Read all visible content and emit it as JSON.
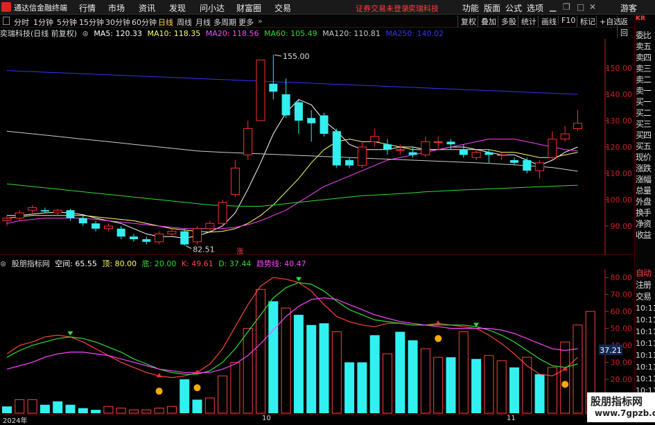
{
  "menubar": {
    "app_title": "通达信金融终端",
    "menus": [
      "行情",
      "市场",
      "资讯",
      "发现",
      "问小达",
      "财富圈",
      "交易"
    ],
    "notice": "证券交易未登录",
    "stock_name": "奕瑞科技",
    "right_items": [
      "功能",
      "版面",
      "公式",
      "选项"
    ],
    "guest": "游客"
  },
  "toolbar": {
    "periods": [
      "分时",
      "1分钟",
      "5分钟",
      "15分钟",
      "30分钟",
      "60分钟",
      "日线",
      "周线",
      "月线",
      "多周期",
      "更多"
    ],
    "active_period": "日线",
    "buttons": [
      "复权",
      "叠加",
      "多股",
      "统计",
      "画线",
      "F10",
      "标记",
      "+自选",
      "返回"
    ]
  },
  "main_chart": {
    "title": "奕瑞科技(日线 前复权)",
    "ma": [
      {
        "label": "MA5: 120.33",
        "color": "#ffffff"
      },
      {
        "label": "MA10: 118.35",
        "color": "#ffff66"
      },
      {
        "label": "MA20: 118.56",
        "color": "#ff44ff"
      },
      {
        "label": "MA60: 105.49",
        "color": "#33dd33"
      },
      {
        "label": "MA120: 110.81",
        "color": "#cccccc"
      },
      {
        "label": "MA250: 140.02",
        "color": "#3333ff"
      }
    ],
    "high_label": "155.00",
    "low_label": "82.51",
    "marker": "涨",
    "axis_color": "#cc2222"
  },
  "indicator": {
    "name": "股朋指标网",
    "values": [
      {
        "label": "空间: 65.55",
        "color": "#ffffff"
      },
      {
        "label": "顶: 80.00",
        "color": "#ffff66"
      },
      {
        "label": "底: 20.00",
        "color": "#33dd33"
      },
      {
        "label": "K: 49.61",
        "color": "#ff4444"
      },
      {
        "label": "D: 37.44",
        "color": "#33dd33"
      },
      {
        "label": "趋势线: 40.47",
        "color": "#ff44ff"
      }
    ],
    "current_value": "37.21"
  },
  "time_axis": [
    "2024年",
    "10",
    "11"
  ],
  "right_panel": {
    "code": "KR",
    "labels": [
      "委比",
      "卖五",
      "卖四",
      "卖三",
      "卖二",
      "卖一",
      "买一",
      "买二",
      "买三",
      "买四",
      "买五",
      "现价",
      "涨跌",
      "涨幅",
      "总量",
      "外盘",
      "换手",
      "净资",
      "收益"
    ],
    "labels2": [
      "自动",
      "注册",
      "交易"
    ],
    "times": [
      "10:11",
      "10:11",
      "10:11",
      "10:11",
      "10:11",
      "10:11",
      "10:11",
      "10:11",
      "10:11"
    ]
  },
  "watermark": {
    "line1": "股朋指标网",
    "line2": "www.7gpzb.com"
  },
  "chart_data": [
    {
      "type": "candlestick",
      "ylim": [
        80,
        160
      ],
      "yticks": [
        90,
        100,
        110,
        120,
        130,
        140,
        150
      ],
      "candles": [
        {
          "o": 92,
          "c": 93,
          "h": 94,
          "l": 90
        },
        {
          "o": 93,
          "c": 95,
          "h": 96,
          "l": 92
        },
        {
          "o": 96,
          "c": 97,
          "h": 98,
          "l": 95
        },
        {
          "o": 96,
          "c": 95.5,
          "h": 97,
          "l": 95
        },
        {
          "o": 95,
          "c": 96,
          "h": 96.5,
          "l": 94
        },
        {
          "o": 96,
          "c": 93,
          "h": 96.5,
          "l": 92
        },
        {
          "o": 93,
          "c": 91,
          "h": 94,
          "l": 90
        },
        {
          "o": 91,
          "c": 89,
          "h": 92,
          "l": 88
        },
        {
          "o": 89,
          "c": 90,
          "h": 91,
          "l": 88
        },
        {
          "o": 89,
          "c": 86,
          "h": 90,
          "l": 85
        },
        {
          "o": 86,
          "c": 85,
          "h": 87,
          "l": 84
        },
        {
          "o": 85,
          "c": 84,
          "h": 86,
          "l": 83
        },
        {
          "o": 84,
          "c": 87,
          "h": 88,
          "l": 83
        },
        {
          "o": 87,
          "c": 88,
          "h": 89,
          "l": 86
        },
        {
          "o": 88,
          "c": 83,
          "h": 89,
          "l": 82.5
        },
        {
          "o": 84,
          "c": 89,
          "h": 90,
          "l": 83
        },
        {
          "o": 89,
          "c": 91,
          "h": 92,
          "l": 88
        },
        {
          "o": 91,
          "c": 99,
          "h": 100,
          "l": 90
        },
        {
          "o": 102,
          "c": 112,
          "h": 115,
          "l": 101
        },
        {
          "o": 117,
          "c": 127,
          "h": 130,
          "l": 115
        },
        {
          "o": 130,
          "c": 153,
          "h": 153,
          "l": 130
        },
        {
          "o": 144,
          "c": 141,
          "h": 155,
          "l": 138
        },
        {
          "o": 140,
          "c": 132,
          "h": 146,
          "l": 131
        },
        {
          "o": 137,
          "c": 130,
          "h": 138,
          "l": 125
        },
        {
          "o": 131,
          "c": 129,
          "h": 134,
          "l": 122
        },
        {
          "o": 132,
          "c": 125,
          "h": 133,
          "l": 124
        },
        {
          "o": 126,
          "c": 113,
          "h": 127,
          "l": 112
        },
        {
          "o": 115,
          "c": 113,
          "h": 116,
          "l": 112
        },
        {
          "o": 113,
          "c": 120,
          "h": 122,
          "l": 112
        },
        {
          "o": 122,
          "c": 124,
          "h": 127,
          "l": 120
        },
        {
          "o": 121,
          "c": 119,
          "h": 123,
          "l": 117
        },
        {
          "o": 119,
          "c": 119,
          "h": 121,
          "l": 117
        },
        {
          "o": 118,
          "c": 117,
          "h": 120,
          "l": 116
        },
        {
          "o": 117,
          "c": 122,
          "h": 124,
          "l": 116
        },
        {
          "o": 122,
          "c": 122,
          "h": 124,
          "l": 119
        },
        {
          "o": 122,
          "c": 121,
          "h": 123,
          "l": 119
        },
        {
          "o": 119,
          "c": 117,
          "h": 121,
          "l": 116
        },
        {
          "o": 116,
          "c": 118,
          "h": 119,
          "l": 115
        },
        {
          "o": 118,
          "c": 117,
          "h": 119,
          "l": 114
        },
        {
          "o": 117,
          "c": 117,
          "h": 118,
          "l": 115
        },
        {
          "o": 115,
          "c": 114,
          "h": 116,
          "l": 113
        },
        {
          "o": 115,
          "c": 111,
          "h": 116,
          "l": 110
        },
        {
          "o": 111,
          "c": 114,
          "h": 115,
          "l": 108
        },
        {
          "o": 116,
          "c": 123,
          "h": 126,
          "l": 115
        },
        {
          "o": 123,
          "c": 125,
          "h": 128,
          "l": 122
        },
        {
          "o": 127,
          "c": 129,
          "h": 134,
          "l": 126
        }
      ],
      "series": [
        {
          "name": "MA5",
          "color": "#ffffff",
          "values": [
            94,
            94,
            94.5,
            95,
            95.2,
            95,
            94.3,
            93,
            92,
            91,
            89,
            87,
            86,
            86,
            85.4,
            86.2,
            87.8,
            90,
            95,
            104,
            114,
            125,
            133,
            138,
            136,
            130,
            126,
            121,
            119,
            119,
            119,
            120,
            120,
            119,
            119,
            120,
            120,
            119,
            118,
            117,
            117,
            115,
            113,
            115,
            118,
            120
          ]
        },
        {
          "name": "MA10",
          "color": "#ffff66",
          "values": [
            93,
            93.5,
            94,
            94,
            94,
            94,
            94,
            93.5,
            93,
            92.5,
            92,
            91,
            90,
            89,
            88.5,
            88,
            87.7,
            88,
            89,
            91,
            94,
            98,
            103,
            108,
            114,
            119,
            122,
            123,
            122,
            122,
            121,
            120,
            119,
            119,
            119,
            119,
            119,
            119,
            119,
            118,
            118,
            117,
            116,
            116,
            117,
            118
          ]
        },
        {
          "name": "MA20",
          "color": "#ff44ff",
          "values": [
            91,
            92,
            92.5,
            93,
            93,
            93,
            93,
            92.5,
            92,
            91.5,
            91,
            90.5,
            90,
            89.5,
            89,
            89,
            89,
            89,
            89.5,
            90.5,
            92,
            94,
            96,
            99,
            102,
            105,
            107,
            109,
            111,
            113,
            115,
            116,
            117,
            118,
            119,
            120,
            121,
            122,
            123,
            123,
            123,
            122,
            121,
            120,
            119,
            118.5
          ]
        },
        {
          "name": "MA60",
          "color": "#33dd33",
          "values": [
            106,
            105.5,
            105,
            104.5,
            104,
            103.5,
            103,
            102.5,
            102,
            101.5,
            101,
            100.5,
            100,
            99.5,
            99,
            98.5,
            98,
            97.8,
            97.6,
            97.5,
            97.5,
            98,
            98.5,
            99,
            99.5,
            100,
            100.5,
            101,
            101.5,
            101.8,
            102,
            102.3,
            102.6,
            103,
            103.2,
            103.5,
            103.7,
            103.9,
            104.1,
            104.3,
            104.5,
            104.7,
            104.9,
            105.1,
            105.3,
            105.5
          ]
        },
        {
          "name": "MA120",
          "color": "#cccccc",
          "values": [
            126,
            125.5,
            125,
            124.5,
            124,
            123.5,
            123,
            122.5,
            122,
            121.5,
            121,
            120.5,
            120,
            119.5,
            119,
            118.5,
            118.2,
            118,
            117.8,
            117.6,
            117.4,
            117.2,
            117,
            116.8,
            116.6,
            116.4,
            116.2,
            116,
            115.8,
            115.6,
            115.4,
            115.2,
            115,
            114.8,
            114.6,
            114.4,
            114.2,
            114,
            113.8,
            113.5,
            113.2,
            112.9,
            112.6,
            112.2,
            111.5,
            110.8
          ]
        },
        {
          "name": "MA250",
          "color": "#3333ff",
          "values": [
            149,
            148.8,
            148.6,
            148.4,
            148.2,
            148,
            147.8,
            147.6,
            147.4,
            147.2,
            147,
            146.8,
            146.6,
            146.4,
            146.2,
            146,
            145.8,
            145.6,
            145.4,
            145.2,
            145,
            144.8,
            144.6,
            144.4,
            144.2,
            144,
            143.8,
            143.6,
            143.4,
            143.2,
            143,
            142.8,
            142.6,
            142.4,
            142.2,
            142,
            141.8,
            141.6,
            141.4,
            141.2,
            141,
            140.8,
            140.6,
            140.4,
            140.2,
            140.02
          ]
        }
      ]
    },
    {
      "type": "bar",
      "ylim": [
        0,
        85
      ],
      "yticks": [
        20,
        30,
        40,
        50,
        60,
        70,
        80
      ],
      "values": [
        4,
        8,
        8,
        5,
        7,
        5,
        3,
        2,
        4,
        3,
        2,
        2,
        3,
        4,
        20,
        8,
        9,
        22,
        30,
        50,
        73,
        66,
        62,
        58,
        52,
        53,
        48,
        30,
        30,
        46,
        35,
        48,
        43,
        38,
        33,
        33,
        48,
        32,
        34,
        31,
        27,
        33,
        23,
        27,
        42,
        52,
        60
      ],
      "bar_colors": [
        "cyan",
        "red",
        "red",
        "cyan",
        "cyan",
        "cyan",
        "cyan",
        "cyan",
        "red",
        "red",
        "red",
        "red",
        "red",
        "red",
        "cyan",
        "cyan",
        "red",
        "red",
        "red",
        "red",
        "red",
        "cyan",
        "red",
        "cyan",
        "cyan",
        "cyan",
        "red",
        "cyan",
        "cyan",
        "cyan",
        "red",
        "cyan",
        "cyan",
        "red",
        "red",
        "cyan",
        "red",
        "cyan",
        "red",
        "red",
        "cyan",
        "red",
        "cyan",
        "red",
        "red",
        "red",
        "red"
      ],
      "series": [
        {
          "name": "K",
          "color": "#ff4444",
          "values": [
            35,
            40,
            42,
            45,
            46,
            45,
            42,
            38,
            34,
            30,
            27,
            24,
            22,
            21,
            22,
            24,
            29,
            38,
            51,
            64,
            75,
            80,
            79,
            77,
            72,
            64,
            57,
            54,
            52,
            51,
            53,
            53,
            52,
            52,
            53,
            52,
            51,
            50,
            46,
            41,
            35,
            28,
            23,
            22,
            26,
            33
          ]
        },
        {
          "name": "D",
          "color": "#33dd33",
          "values": [
            33,
            37,
            40,
            42,
            44,
            45,
            44,
            42,
            39,
            36,
            32,
            29,
            26,
            24,
            23,
            23,
            25,
            30,
            38,
            48,
            58,
            68,
            74,
            77,
            76,
            72,
            66,
            61,
            58,
            55,
            54,
            53,
            52,
            52,
            52,
            52,
            52,
            51,
            49,
            46,
            42,
            37,
            32,
            28,
            27,
            29
          ]
        },
        {
          "name": "趋势线",
          "color": "#ff44ff",
          "values": [
            26,
            28,
            30,
            33,
            35,
            36,
            36,
            35,
            34,
            32,
            30,
            28,
            26,
            25,
            24,
            24,
            24,
            26,
            29,
            34,
            41,
            49,
            57,
            63,
            67,
            68,
            67,
            64,
            61,
            58,
            56,
            54,
            53,
            52,
            51,
            50,
            50,
            50,
            50,
            49,
            47,
            44,
            41,
            38,
            37,
            38
          ]
        }
      ]
    }
  ]
}
